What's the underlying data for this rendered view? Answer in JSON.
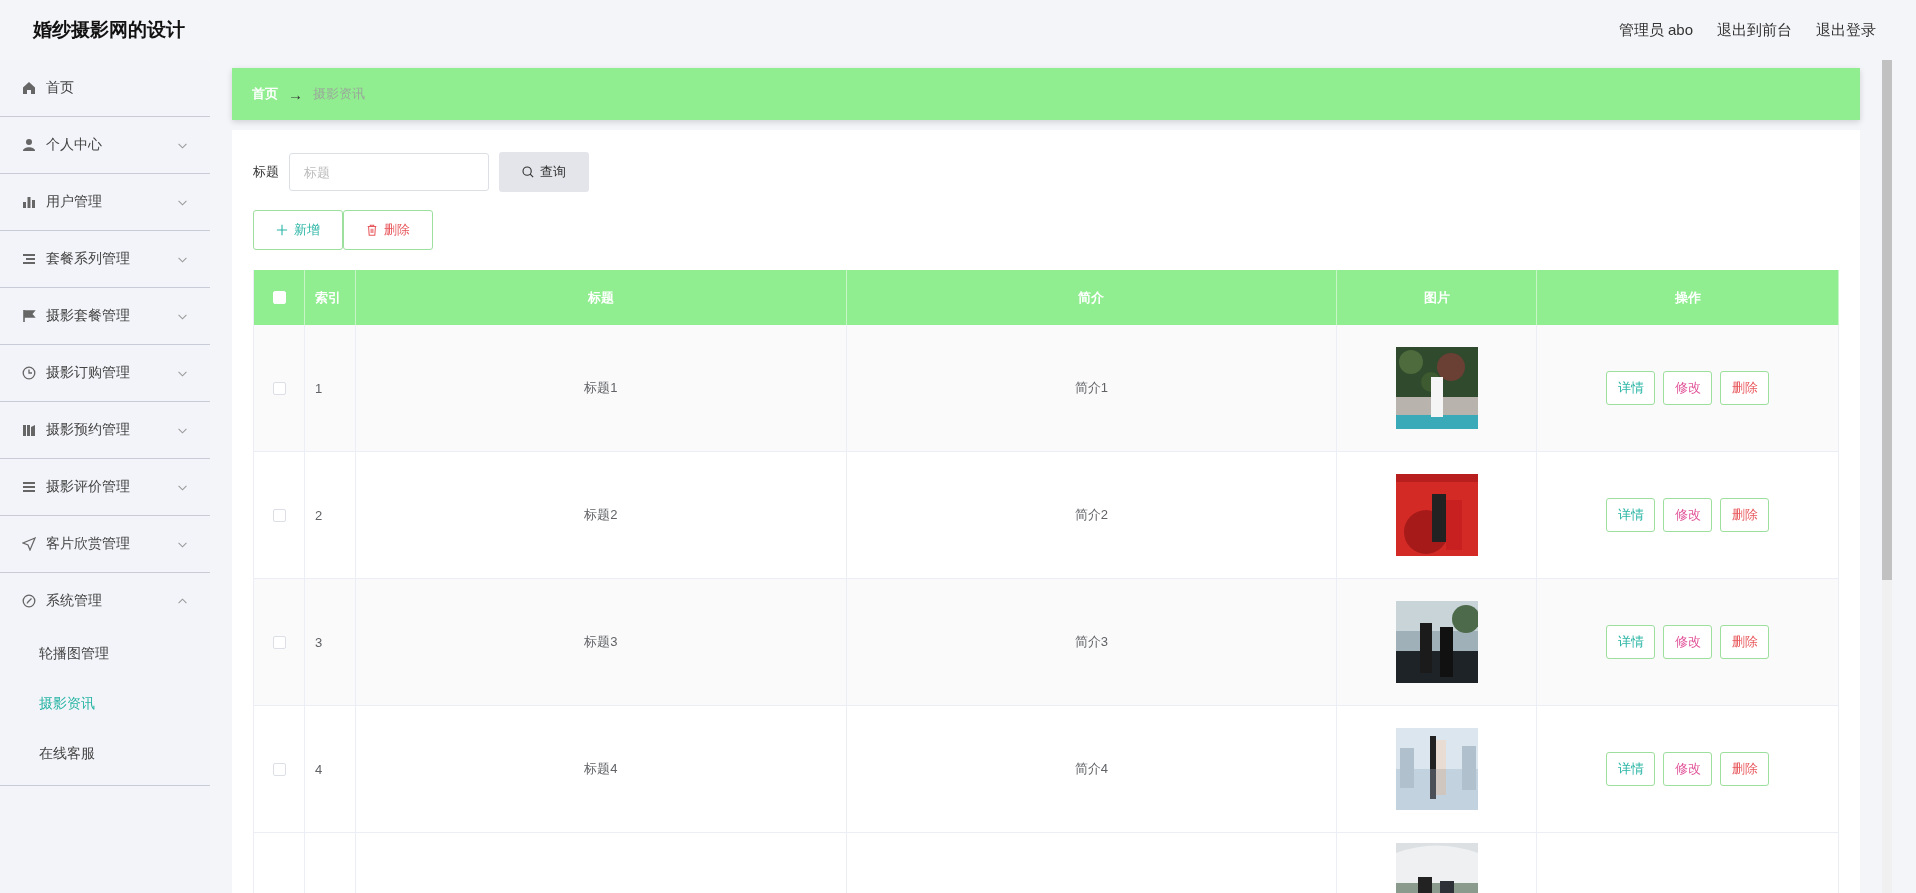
{
  "header": {
    "title": "婚纱摄影网的设计",
    "links": [
      "管理员 abo",
      "退出到前台",
      "退出登录"
    ]
  },
  "sidebar": {
    "items": [
      {
        "label": "首页",
        "has_arrow": false
      },
      {
        "label": "个人中心",
        "expanded": false,
        "has_arrow": true
      },
      {
        "label": "用户管理",
        "expanded": false,
        "has_arrow": true
      },
      {
        "label": "套餐系列管理",
        "expanded": false,
        "has_arrow": true
      },
      {
        "label": "摄影套餐管理",
        "expanded": false,
        "has_arrow": true
      },
      {
        "label": "摄影订购管理",
        "expanded": false,
        "has_arrow": true
      },
      {
        "label": "摄影预约管理",
        "expanded": false,
        "has_arrow": true
      },
      {
        "label": "摄影评价管理",
        "expanded": false,
        "has_arrow": true
      },
      {
        "label": "客片欣赏管理",
        "expanded": false,
        "has_arrow": true
      },
      {
        "label": "系统管理",
        "expanded": true,
        "has_arrow": true,
        "children": [
          {
            "label": "轮播图管理",
            "selected": false
          },
          {
            "label": "摄影资讯",
            "selected": true
          },
          {
            "label": "在线客服",
            "selected": false
          }
        ]
      }
    ]
  },
  "breadcrumb": {
    "home": "首页",
    "separator": "→",
    "current": "摄影资讯"
  },
  "search": {
    "label": "标题",
    "placeholder": "标题",
    "button": "查询"
  },
  "actions": {
    "add": "新增",
    "delete": "删除"
  },
  "table": {
    "header_checked": false,
    "columns": [
      "索引",
      "标题",
      "简介",
      "图片",
      "操作"
    ],
    "rows": [
      {
        "checked": false,
        "index": "1",
        "title": "标题1",
        "intro": "简介1",
        "buttons": [
          "详情",
          "修改",
          "删除"
        ]
      },
      {
        "checked": false,
        "index": "2",
        "title": "标题2",
        "intro": "简介2",
        "buttons": [
          "详情",
          "修改",
          "删除"
        ]
      },
      {
        "checked": false,
        "index": "3",
        "title": "标题3",
        "intro": "简介3",
        "buttons": [
          "详情",
          "修改",
          "删除"
        ]
      },
      {
        "checked": false,
        "index": "4",
        "title": "标题4",
        "intro": "简介4",
        "buttons": [
          "详情",
          "修改",
          "删除"
        ]
      }
    ]
  }
}
